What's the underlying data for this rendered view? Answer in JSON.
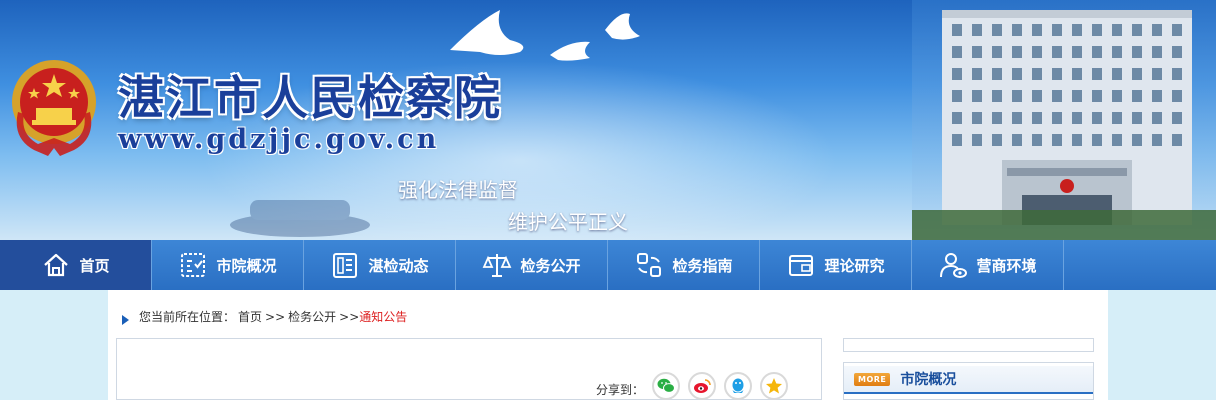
{
  "header": {
    "site_title": "湛江市人民检察院",
    "site_url": "www.gdzjjc.gov.cn",
    "slogan_1": "强化法律监督",
    "slogan_2": "维护公平正义"
  },
  "nav": {
    "items": [
      {
        "label": "首页",
        "icon": "home-icon",
        "active": true
      },
      {
        "label": "市院概况",
        "icon": "overview-icon",
        "active": false
      },
      {
        "label": "湛检动态",
        "icon": "news-icon",
        "active": false
      },
      {
        "label": "检务公开",
        "icon": "scales-icon",
        "active": false
      },
      {
        "label": "检务指南",
        "icon": "guide-icon",
        "active": false
      },
      {
        "label": "理论研究",
        "icon": "research-icon",
        "active": false
      },
      {
        "label": "营商环境",
        "icon": "business-icon",
        "active": false
      }
    ]
  },
  "breadcrumb": {
    "prefix": "您当前所在位置：",
    "home": "首页",
    "sep1": ">>",
    "section": "检务公开",
    "sep2": ">>",
    "current": "通知公告"
  },
  "share": {
    "label": "分享到：",
    "targets": [
      "wechat-icon",
      "weibo-icon",
      "qq-icon",
      "qzone-icon"
    ]
  },
  "sidebar": {
    "more_tag": "MORE",
    "title": "市院概况"
  },
  "colors": {
    "nav_bg": "#2a6fc3",
    "nav_active": "#234e9c",
    "title": "#1a3f9a",
    "breadcrumb_current": "#dd2222",
    "wechat": "#2aae44",
    "weibo": "#e6162d",
    "qq": "#1e9fe6",
    "qzone": "#f5b60b"
  }
}
